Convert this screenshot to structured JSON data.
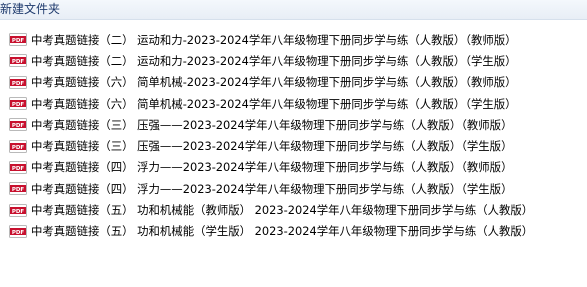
{
  "window": {
    "title": "新建文件夹"
  },
  "icon": {
    "name": "pdf-file-icon",
    "label": "PDF",
    "color": "#c8102e"
  },
  "files": [
    {
      "name": "中考真题链接（二） 运动和力-2023-2024学年八年级物理下册同步学与练（人教版）（教师版）"
    },
    {
      "name": "中考真题链接（二） 运动和力-2023-2024学年八年级物理下册同步学与练（人教版）（学生版）"
    },
    {
      "name": "中考真题链接（六） 简单机械-2023-2024学年八年级物理下册同步学与练（人教版）（教师版）"
    },
    {
      "name": "中考真题链接（六） 简单机械-2023-2024学年八年级物理下册同步学与练（人教版）（学生版）"
    },
    {
      "name": "中考真题链接（三） 压强——2023-2024学年八年级物理下册同步学与练（人教版）（教师版）"
    },
    {
      "name": "中考真题链接（三） 压强——2023-2024学年八年级物理下册同步学与练（人教版）（学生版）"
    },
    {
      "name": "中考真题链接（四） 浮力——2023-2024学年八年级物理下册同步学与练（人教版）（教师版）"
    },
    {
      "name": "中考真题链接（四） 浮力——2023-2024学年八年级物理下册同步学与练（人教版）（学生版）"
    },
    {
      "name": "中考真题链接（五） 功和机械能（教师版） 2023-2024学年八年级物理下册同步学与练（人教版）"
    },
    {
      "name": "中考真题链接（五） 功和机械能（学生版） 2023-2024学年八年级物理下册同步学与练（人教版）"
    }
  ]
}
